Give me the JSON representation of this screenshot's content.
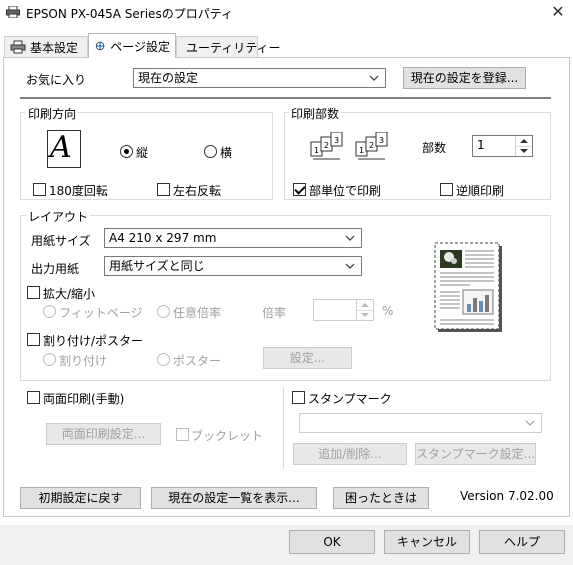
{
  "window": {
    "title": "EPSON PX-045A Seriesのプロパティ",
    "close_glyph": "✕"
  },
  "tabs": [
    {
      "label": "基本設定",
      "icon": "printer-icon"
    },
    {
      "label": "ページ設定",
      "icon": "page-setup-icon",
      "active": true
    },
    {
      "label": "ユーティリティー",
      "icon": "utility-icon"
    }
  ],
  "favorites": {
    "label": "お気に入り",
    "value": "現在の設定",
    "register_button": "現在の設定を登録..."
  },
  "orientation": {
    "group": "印刷方向",
    "icon_letter": "A",
    "portrait": "縦",
    "landscape": "横",
    "selected": "portrait",
    "rotate180": "180度回転",
    "mirror": "左右反転"
  },
  "copies": {
    "group": "印刷部数",
    "count_label": "部数",
    "count_value": "1",
    "collate": "部単位で印刷",
    "collate_checked": true,
    "reverse": "逆順印刷",
    "collate_numbers": [
      "1",
      "2",
      "3"
    ]
  },
  "layout": {
    "group": "レイアウト",
    "paper_size_label": "用紙サイズ",
    "paper_size_value": "A4 210 x 297 mm",
    "output_paper_label": "出力用紙",
    "output_paper_value": "用紙サイズと同じ",
    "scale_label": "拡大/縮小",
    "fit_page": "フィットページ",
    "custom_scale": "任意倍率",
    "ratio_label": "倍率",
    "ratio_unit": "%",
    "multi_label": "割り付け/ポスター",
    "nup": "割り付け",
    "poster": "ポスター",
    "settings_button": "設定..."
  },
  "duplex": {
    "label": "両面印刷(手動)",
    "settings_button": "両面印刷設定...",
    "booklet": "ブックレット"
  },
  "stamp": {
    "label": "スタンプマーク",
    "add_remove_button": "追加/削除...",
    "settings_button": "スタンプマーク設定..."
  },
  "footer": {
    "defaults_button": "初期設定に戻す",
    "list_button": "現在の設定一覧を表示...",
    "help_button": "困ったときは",
    "version": "Version 7.02.00"
  },
  "dialog_buttons": {
    "ok": "OK",
    "cancel": "キャンセル",
    "help": "ヘルプ"
  }
}
